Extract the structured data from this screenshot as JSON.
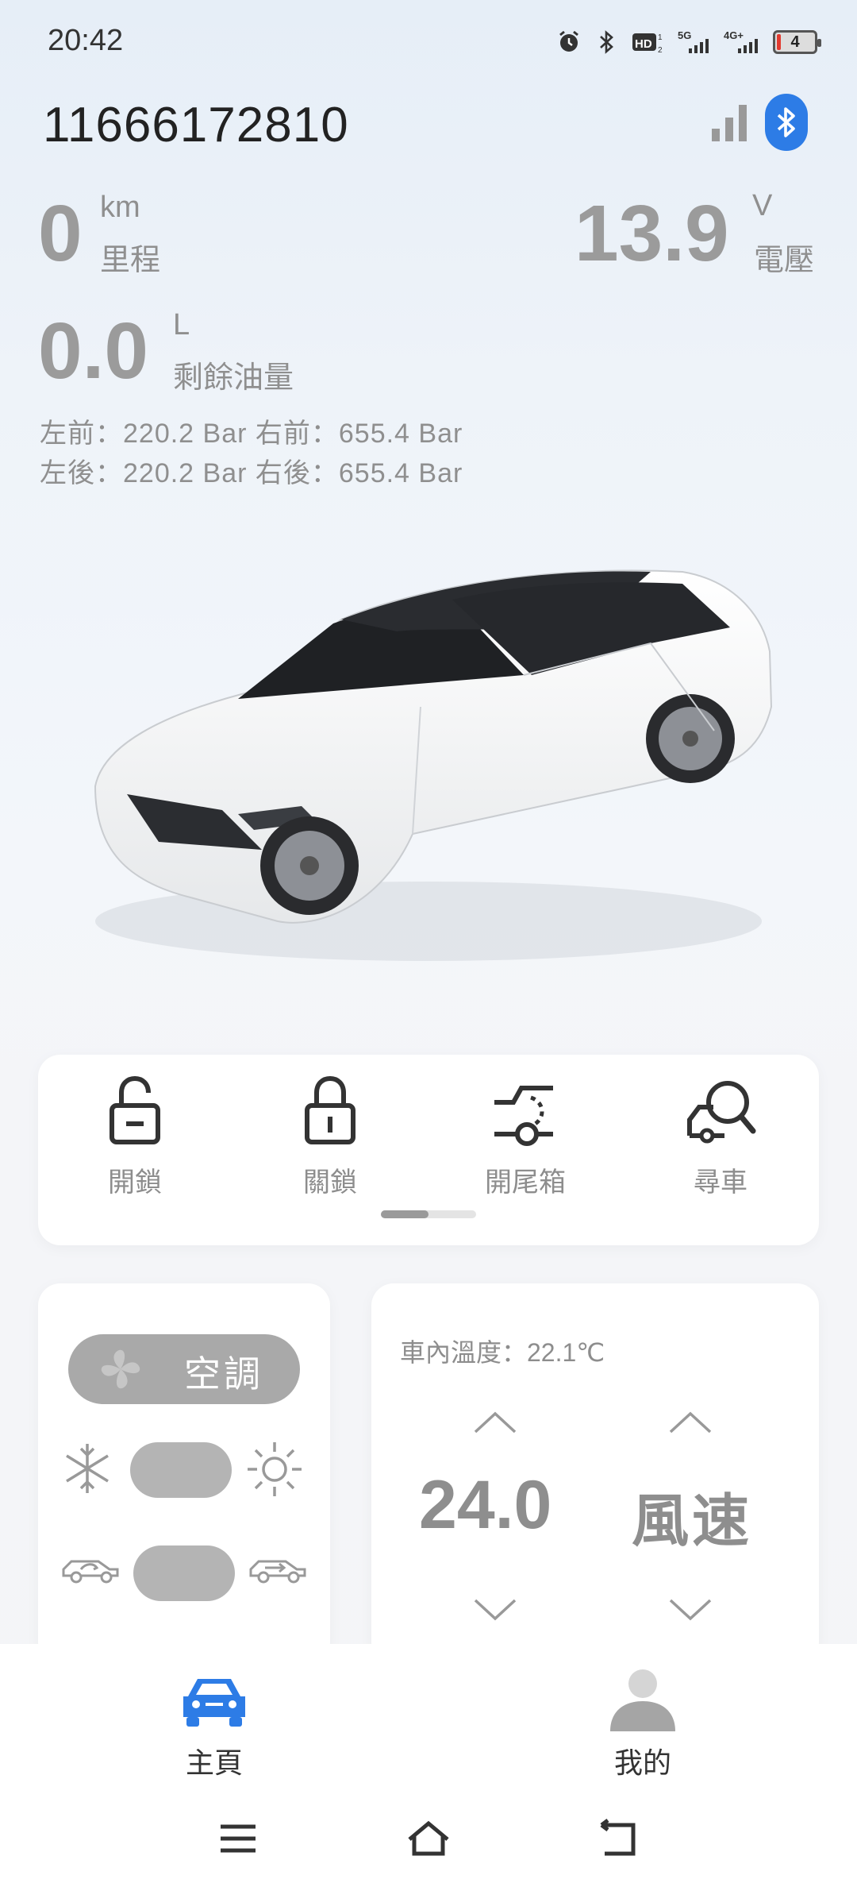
{
  "status_bar": {
    "time": "20:42",
    "icons": [
      "alarm-icon",
      "bluetooth-icon",
      "hd-icon",
      "5g-signal-icon",
      "4g-signal-icon"
    ],
    "network_5g": "5G",
    "network_4g": "4G+",
    "hd": "HD",
    "battery": "4"
  },
  "header": {
    "device_id": "11666172810",
    "signal_icon": "signal-bars-icon",
    "bluetooth_icon": "bluetooth-icon",
    "accent": "#2d7ce6"
  },
  "metrics": {
    "mileage": {
      "value": "0",
      "unit": "km",
      "label": "里程"
    },
    "voltage": {
      "value": "13.9",
      "unit": "V",
      "label": "電壓"
    },
    "fuel": {
      "value": "0.0",
      "unit": "L",
      "label": "剩餘油量"
    }
  },
  "tires": {
    "row1": "左前：220.2 Bar  右前：655.4 Bar",
    "row2": "左後：220.2 Bar  右後：655.4 Bar"
  },
  "actions": [
    {
      "label": "開鎖",
      "icon": "unlock-icon"
    },
    {
      "label": "關鎖",
      "icon": "lock-icon"
    },
    {
      "label": "開尾箱",
      "icon": "trunk-icon"
    },
    {
      "label": "尋車",
      "icon": "find-car-icon"
    }
  ],
  "climate": {
    "ac_label": "空調",
    "cabin_temp": "車內溫度：22.1℃",
    "setpoint": "24.0",
    "fan_speed_label": "風速"
  },
  "tabs": [
    {
      "label": "主頁",
      "icon": "car-icon",
      "active": true
    },
    {
      "label": "我的",
      "icon": "user-icon",
      "active": false
    }
  ],
  "nav": [
    "menu-icon",
    "home-icon",
    "back-icon"
  ]
}
